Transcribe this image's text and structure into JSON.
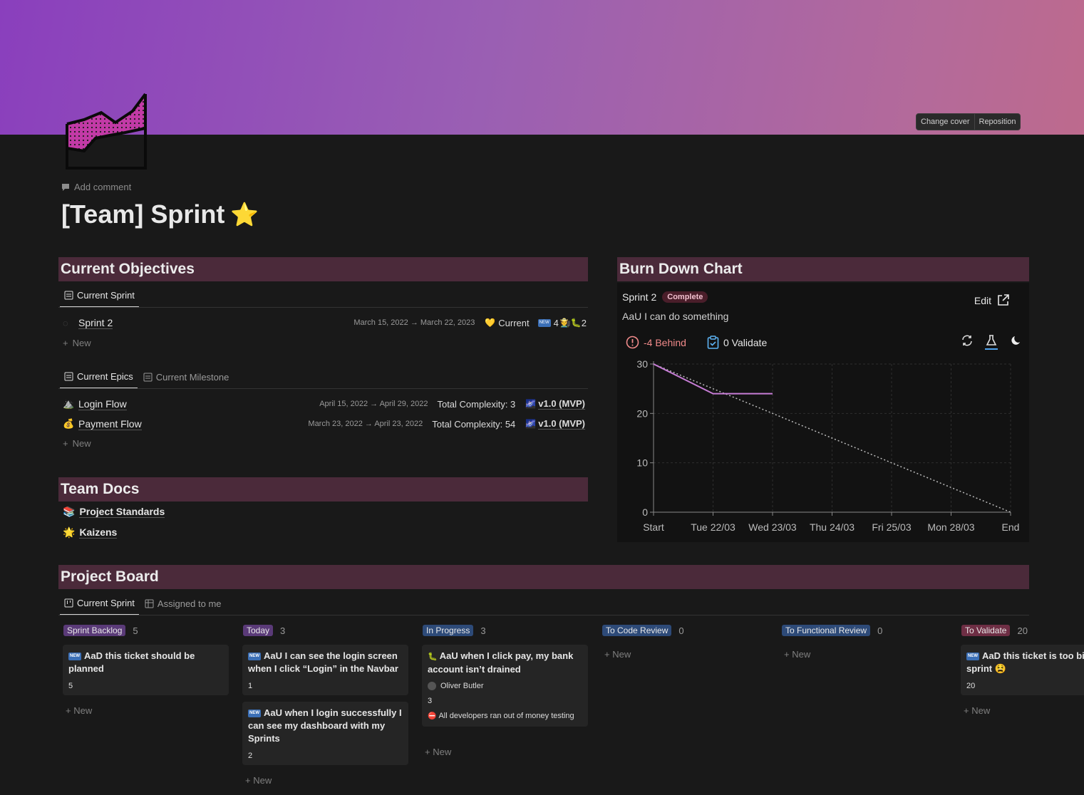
{
  "cover": {
    "change_cover": "Change cover",
    "reposition": "Reposition"
  },
  "add_comment": "Add comment",
  "title": "[Team] Sprint",
  "objectives": {
    "heading": "Current Objectives",
    "tab_sprint": "Current Sprint",
    "sprint": {
      "name": "Sprint 2",
      "dates": "March 15, 2022 → March 22, 2023",
      "status": "Current",
      "new_count": "4",
      "bug_count": "2"
    },
    "new_label": "New",
    "tab_epics": "Current Epics",
    "tab_milestone": "Current Milestone",
    "epics": [
      {
        "name": "Login Flow",
        "dates": "April 15, 2022 → April 29, 2022",
        "complexity": "Total Complexity: 3",
        "milestone": "v1.0 (MVP)"
      },
      {
        "name": "Payment Flow",
        "dates": "March 23, 2022 → April 23, 2022",
        "complexity": "Total Complexity: 54",
        "milestone": "v1.0 (MVP)"
      }
    ]
  },
  "docs": {
    "heading": "Team Docs",
    "items": [
      "Project Standards",
      "Kaizens"
    ]
  },
  "burndown": {
    "heading": "Burn Down Chart",
    "sprint": "Sprint 2",
    "badge": "Complete",
    "subtitle": "AaU I can do something",
    "edit": "Edit",
    "behind": "-4 Behind",
    "validate": "0 Validate"
  },
  "chart_data": {
    "type": "line",
    "categories": [
      "Start",
      "Tue 22/03",
      "Wed 23/03",
      "Thu 24/03",
      "Fri 25/03",
      "Mon 28/03",
      "End"
    ],
    "series": [
      {
        "values": [
          30,
          24,
          24,
          null,
          null,
          null,
          null
        ],
        "color": "#c77dd6"
      },
      {
        "values": [
          30,
          25,
          20,
          15,
          10,
          5,
          0
        ],
        "color": "#bbbbbb"
      }
    ],
    "yticks": [
      0,
      10,
      20,
      30
    ],
    "ylim": [
      0,
      30
    ],
    "grid": true
  },
  "board": {
    "heading": "Project Board",
    "tab_sprint": "Current Sprint",
    "tab_assigned": "Assigned to me",
    "new_label": "New",
    "columns": [
      {
        "name": "Sprint Backlog",
        "count": "5",
        "color": "#5a3a78",
        "cards": [
          {
            "title": "AaD this ticket should be planned",
            "num": "5"
          }
        ]
      },
      {
        "name": "Today",
        "count": "3",
        "color": "#5a3a78",
        "cards": [
          {
            "title": "AaU I can see the login screen when I click “Login” in the Navbar",
            "num": "1"
          },
          {
            "title": "AaU when I login successfully I can see my dashboard with my Sprints",
            "num": "2"
          }
        ]
      },
      {
        "name": "In Progress",
        "count": "3",
        "color": "#2d4a78",
        "cards": [
          {
            "title": "AaU when I click pay, my bank account isn’t drained",
            "person": "Oliver Butler",
            "num": "3",
            "note": "All developers ran out of money testing"
          }
        ]
      },
      {
        "name": "To Code Review",
        "count": "0",
        "color": "#2d4a78",
        "cards": []
      },
      {
        "name": "To Functional Review",
        "count": "0",
        "color": "#2d4a78",
        "cards": []
      },
      {
        "name": "To Validate",
        "count": "20",
        "color": "#6e2e44",
        "cards": [
          {
            "title": "AaD this ticket is too big the sprint",
            "num": "20"
          }
        ]
      }
    ]
  }
}
